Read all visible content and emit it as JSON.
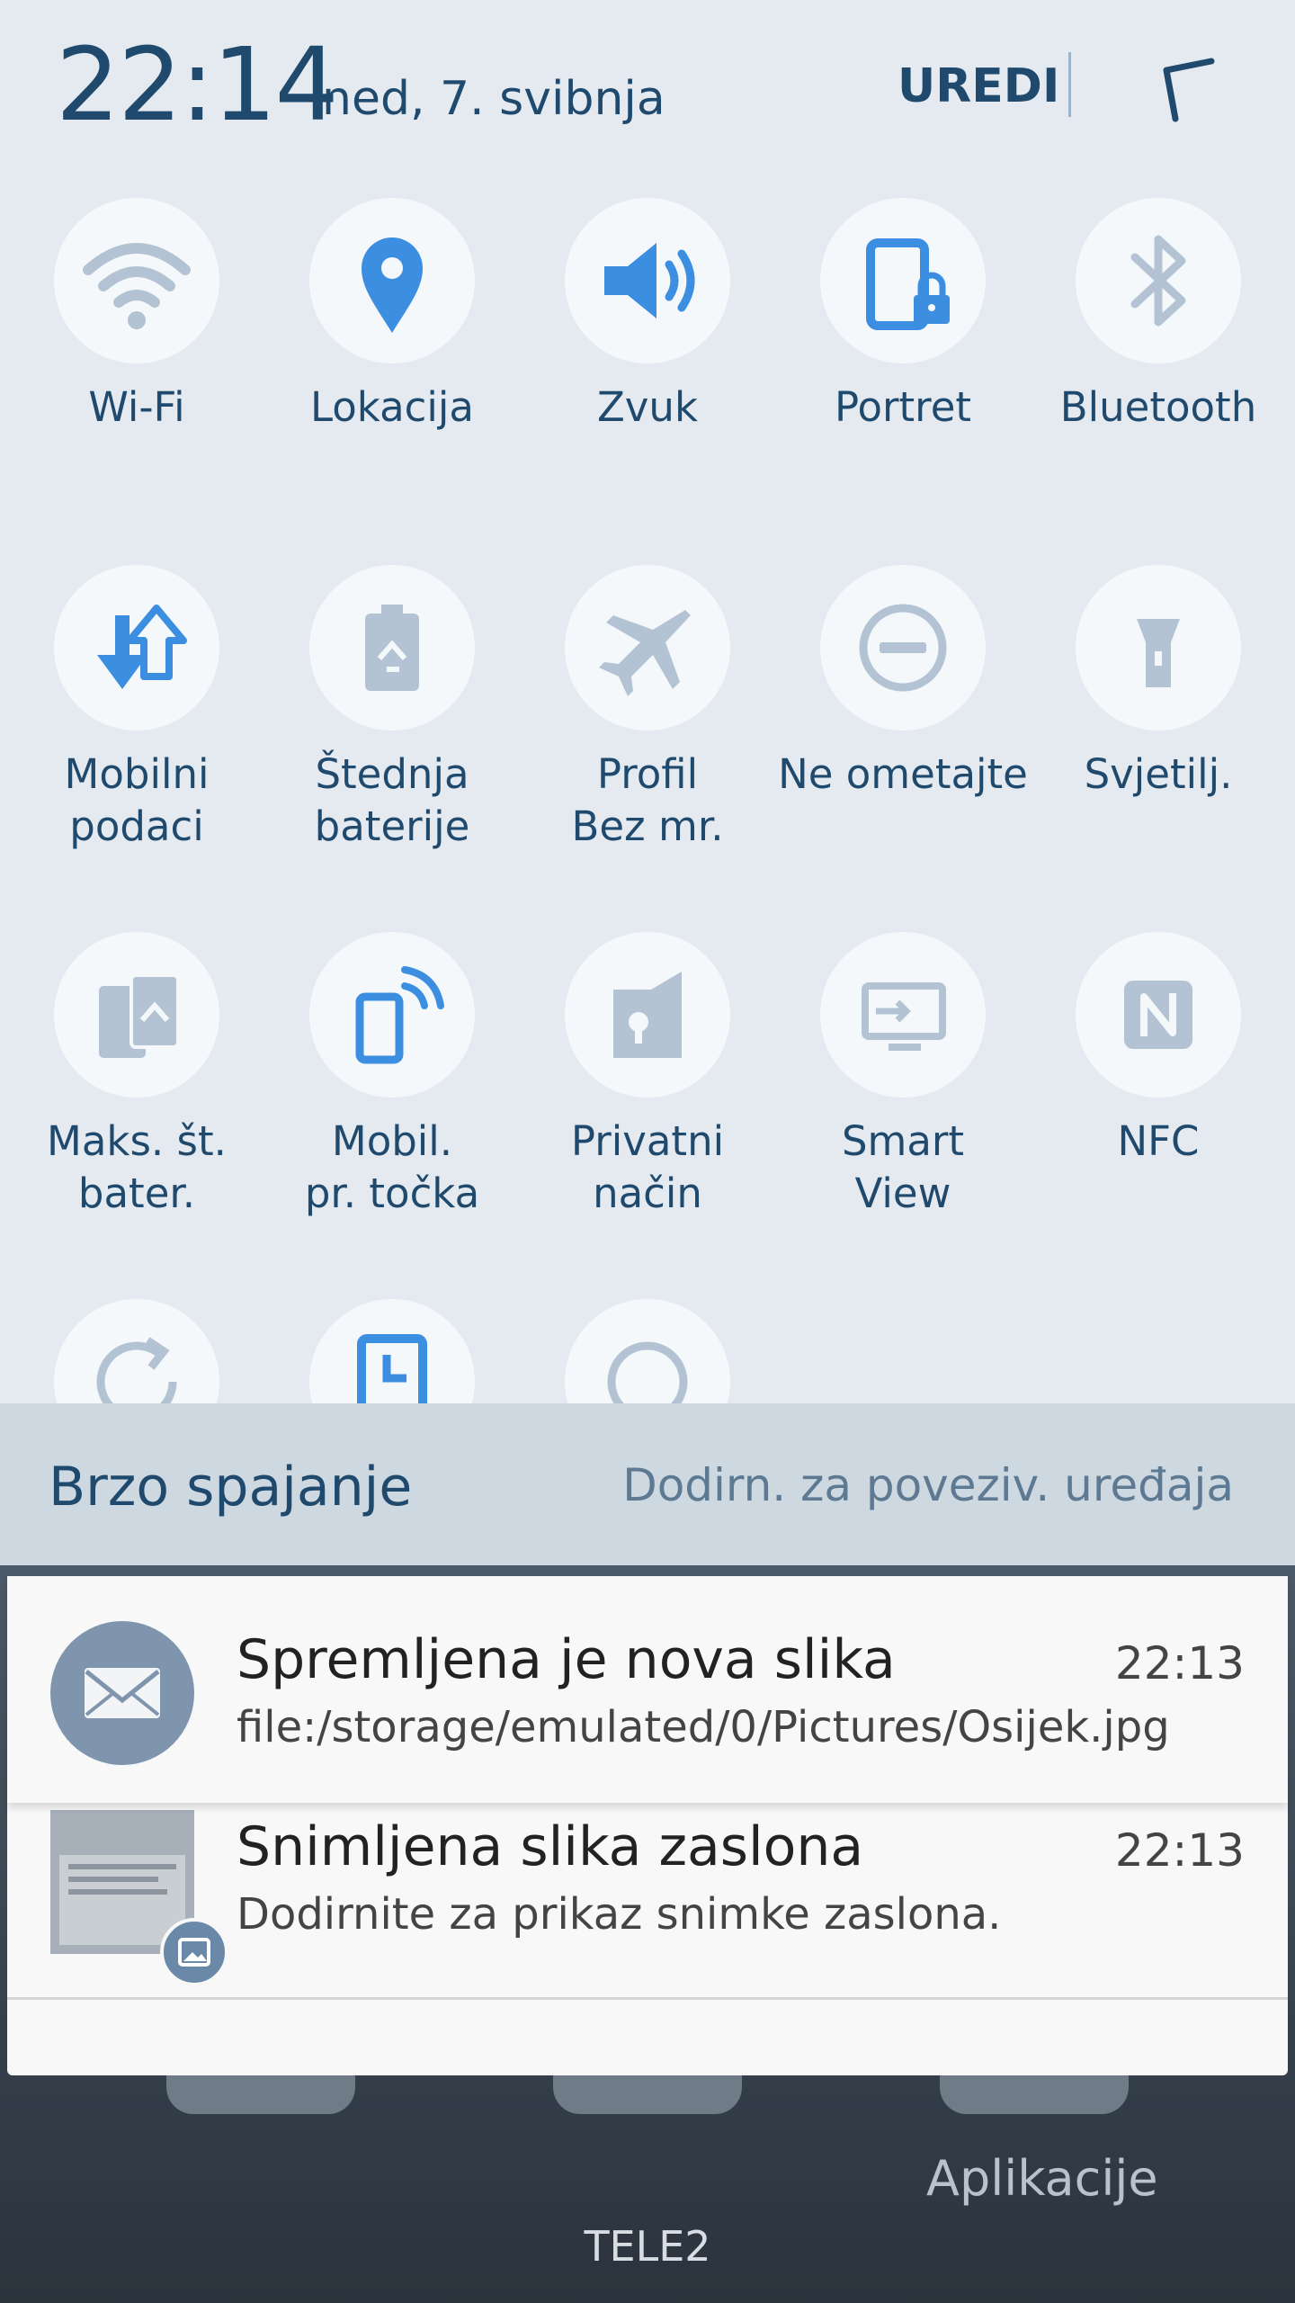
{
  "status": {
    "time": "22:14",
    "date": "ned, 7. svibnja",
    "edit_label": "UREDI"
  },
  "tiles": [
    {
      "label": "Wi-Fi",
      "icon": "wifi-icon",
      "active": false
    },
    {
      "label": "Lokacija",
      "icon": "location-icon",
      "active": true
    },
    {
      "label": "Zvuk",
      "icon": "sound-icon",
      "active": true
    },
    {
      "label": "Portret",
      "icon": "portrait-lock-icon",
      "active": true
    },
    {
      "label": "Bluetooth",
      "icon": "bluetooth-icon",
      "active": false
    },
    {
      "label": "Mobilni\npodaci",
      "icon": "mobile-data-icon",
      "active": true
    },
    {
      "label": "Štednja\nbaterije",
      "icon": "battery-saver-icon",
      "active": false
    },
    {
      "label": "Profil\nBez mr.",
      "icon": "airplane-icon",
      "active": false
    },
    {
      "label": "Ne ometajte",
      "icon": "do-not-disturb-icon",
      "active": false
    },
    {
      "label": "Svjetilj.",
      "icon": "flashlight-icon",
      "active": false
    },
    {
      "label": "Maks. št.\nbater.",
      "icon": "max-battery-saver-icon",
      "active": false
    },
    {
      "label": "Mobil.\npr. točka",
      "icon": "hotspot-icon",
      "active": true
    },
    {
      "label": "Privatni\nnačin",
      "icon": "private-mode-icon",
      "active": false
    },
    {
      "label": "Smart\nView",
      "icon": "smart-view-icon",
      "active": false
    },
    {
      "label": "NFC",
      "icon": "nfc-icon",
      "active": false
    }
  ],
  "quick_connect": {
    "title": "Brzo spajanje",
    "hint": "Dodirn. za poveziv. uređaja"
  },
  "notifications": [
    {
      "title": "Spremljena je nova slika",
      "time": "22:13",
      "body": "file:/storage/emulated/0/Pictures/Osijek.jpg",
      "icon": "mail-icon"
    },
    {
      "title": "Snimljena slika zaslona",
      "time": "22:13",
      "body": "Dodirnite za prikaz snimke zaslona.",
      "icon": "image-icon"
    }
  ],
  "home": {
    "apps_label": "Aplikacije",
    "carrier": "TELE2"
  },
  "colors": {
    "active": "#3b8ee0",
    "inactive": "#b3c3d3",
    "panel": "#e5eaf0",
    "text": "#1f4a6e"
  }
}
